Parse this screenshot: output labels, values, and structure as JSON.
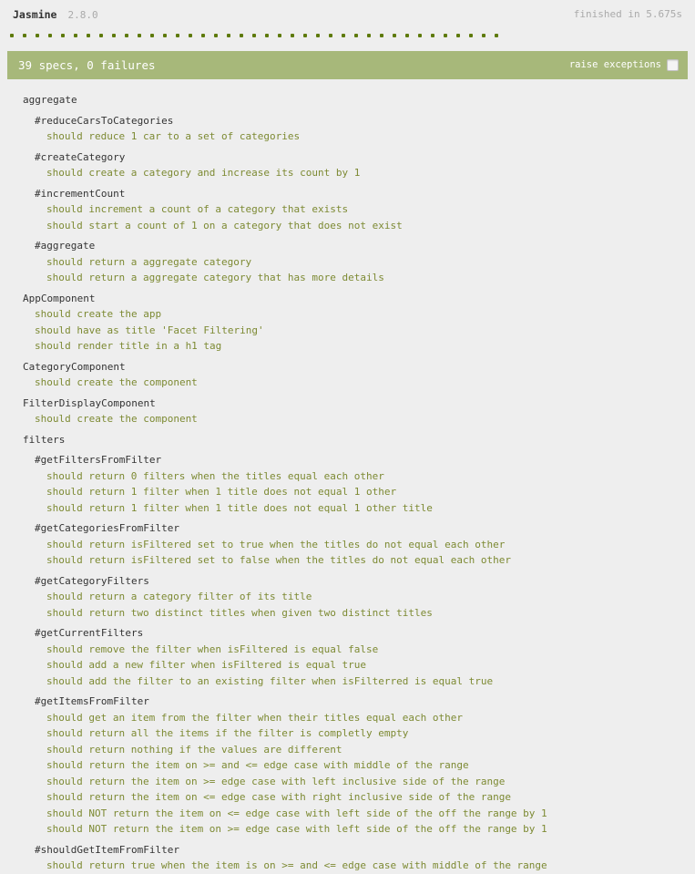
{
  "banner": {
    "title": "Jasmine",
    "version": "2.8.0",
    "duration": "finished in 5.675s"
  },
  "symbol_summary": {
    "total": 39,
    "statuses": [
      "passed",
      "passed",
      "passed",
      "passed",
      "passed",
      "passed",
      "passed",
      "passed",
      "passed",
      "passed",
      "passed",
      "passed",
      "passed",
      "passed",
      "passed",
      "passed",
      "passed",
      "passed",
      "passed",
      "passed",
      "passed",
      "passed",
      "passed",
      "passed",
      "passed",
      "passed",
      "passed",
      "passed",
      "passed",
      "passed",
      "passed",
      "passed",
      "passed",
      "passed",
      "passed",
      "passed",
      "passed",
      "passed",
      "passed"
    ]
  },
  "alert": {
    "result_text": "39 specs, 0 failures",
    "raise_exceptions_label": "raise exceptions",
    "raise_exceptions_checked": false,
    "bar_color": "#a7b87a"
  },
  "colors": {
    "page_background": "#eeeeee",
    "suite_text": "#333333",
    "spec_text": "#7d8a33",
    "passed_symbol": "#5e7a0a",
    "muted_text": "#aaaaaa"
  },
  "results": {
    "suites": [
      {
        "name": "aggregate",
        "specs": [],
        "children": [
          {
            "name": "#reduceCarsToCategories",
            "specs": [
              "should reduce 1 car to a set of categories"
            ]
          },
          {
            "name": "#createCategory",
            "specs": [
              "should create a category and increase its count by 1"
            ]
          },
          {
            "name": "#incrementCount",
            "specs": [
              "should increment a count of a category that exists",
              "should start a count of 1 on a category that does not exist"
            ]
          },
          {
            "name": "#aggregate",
            "specs": [
              "should return a aggregate category",
              "should return a aggregate category that has more details"
            ]
          }
        ]
      },
      {
        "name": "AppComponent",
        "specs": [
          "should create the app",
          "should have as title 'Facet Filtering'",
          "should render title in a h1 tag"
        ],
        "children": []
      },
      {
        "name": "CategoryComponent",
        "specs": [
          "should create the component"
        ],
        "children": []
      },
      {
        "name": "FilterDisplayComponent",
        "specs": [
          "should create the component"
        ],
        "children": []
      },
      {
        "name": "filters",
        "specs": [],
        "children": [
          {
            "name": "#getFiltersFromFilter",
            "specs": [
              "should return 0 filters when the titles equal each other",
              "should return 1 filter when 1 title does not equal 1 other",
              "should return 1 filter when 1 title does not equal 1 other title"
            ]
          },
          {
            "name": "#getCategoriesFromFilter",
            "specs": [
              "should return isFiltered set to true when the titles do not equal each other",
              "should return isFiltered set to false when the titles do not equal each other"
            ]
          },
          {
            "name": "#getCategoryFilters",
            "specs": [
              "should return a category filter of its title",
              "should return two distinct titles when given two distinct titles"
            ]
          },
          {
            "name": "#getCurrentFilters",
            "specs": [
              "should remove the filter when isFiltered is equal false",
              "should add a new filter when isFiltered is equal true",
              "should add the filter to an existing filter when isFilterred is equal true"
            ]
          },
          {
            "name": "#getItemsFromFilter",
            "specs": [
              "should get an item from the filter when their titles equal each other",
              "should return all the items if the filter is completly empty",
              "should return nothing if the values are different",
              "should return the item on >= and <= edge case with middle of the range",
              "should return the item on >= edge case with left inclusive side of the range",
              "should return the item on <= edge case with right inclusive side of the range",
              "should NOT return the item on <= edge case with left side of the off the range by 1",
              "should NOT return the item on >= edge case with left side of the off the range by 1"
            ]
          },
          {
            "name": "#shouldGetItemFromFilter",
            "specs": [
              "should return true when the item is on >= and <= edge case with middle of the range"
            ]
          }
        ]
      }
    ]
  }
}
